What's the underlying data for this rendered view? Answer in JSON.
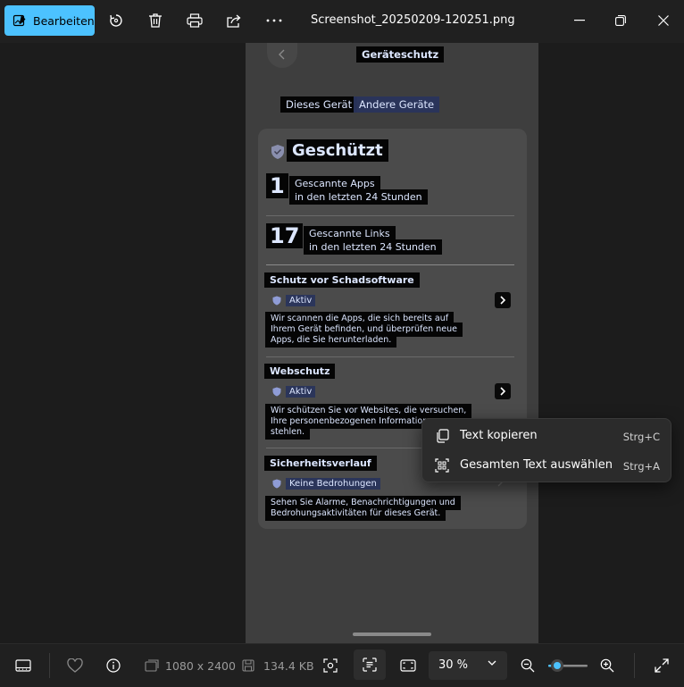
{
  "titlebar": {
    "edit_label": "Bearbeiten",
    "filename": "Screenshot_20250209-120251.png",
    "icons": [
      "edit-image-icon",
      "rotate-icon",
      "delete-icon",
      "print-icon",
      "share-icon",
      "more-icon",
      "minimize-icon",
      "maximize-icon",
      "close-icon"
    ]
  },
  "phone": {
    "header": "Geräteschutz",
    "tabs": [
      "Dieses Gerät",
      "Andere Geräte"
    ],
    "status": "Geschützt",
    "stats": [
      {
        "number": "1",
        "line1": "Gescannte Apps",
        "line2": "in den letzten 24 Stunden"
      },
      {
        "number": "17",
        "line1": "Gescannte Links",
        "line2": "in den letzten 24 Stunden"
      }
    ],
    "sections": [
      {
        "title": "Schutz vor Schadsoftware",
        "badge": "Aktiv",
        "desc1": "Wir scannen die Apps, die sich bereits auf",
        "desc2": "Ihrem Gerät befinden, und überprüfen neue",
        "desc3": "Apps, die Sie herunterladen."
      },
      {
        "title": "Webschutz",
        "badge": "Aktiv",
        "desc1": "Wir schützen Sie vor Websites, die versuchen,",
        "desc2": "Ihre personenbezogenen Informationen",
        "desc3": "stehlen."
      },
      {
        "title": "Sicherheitsverlauf",
        "badge": "Keine Bedrohungen",
        "desc1": "Sehen Sie Alarme, Benachrichtigungen und",
        "desc2": "Bedrohungsaktivitäten für dieses Gerät.",
        "desc3": ""
      }
    ]
  },
  "context_menu": {
    "items": [
      {
        "label": "Text kopieren",
        "shortcut": "Strg+C"
      },
      {
        "label": "Gesamten Text auswählen",
        "shortcut": "Strg+A"
      }
    ]
  },
  "bottombar": {
    "resolution": "1080 x 2400",
    "filesize": "134.4 KB",
    "zoom": "30 %",
    "zoom_slider_level": 0.1
  },
  "colors": {
    "accent": "#4cc2ff",
    "background": "#202020",
    "ocr_highlight": "#050505",
    "selected_text": "#b9c8ff"
  }
}
